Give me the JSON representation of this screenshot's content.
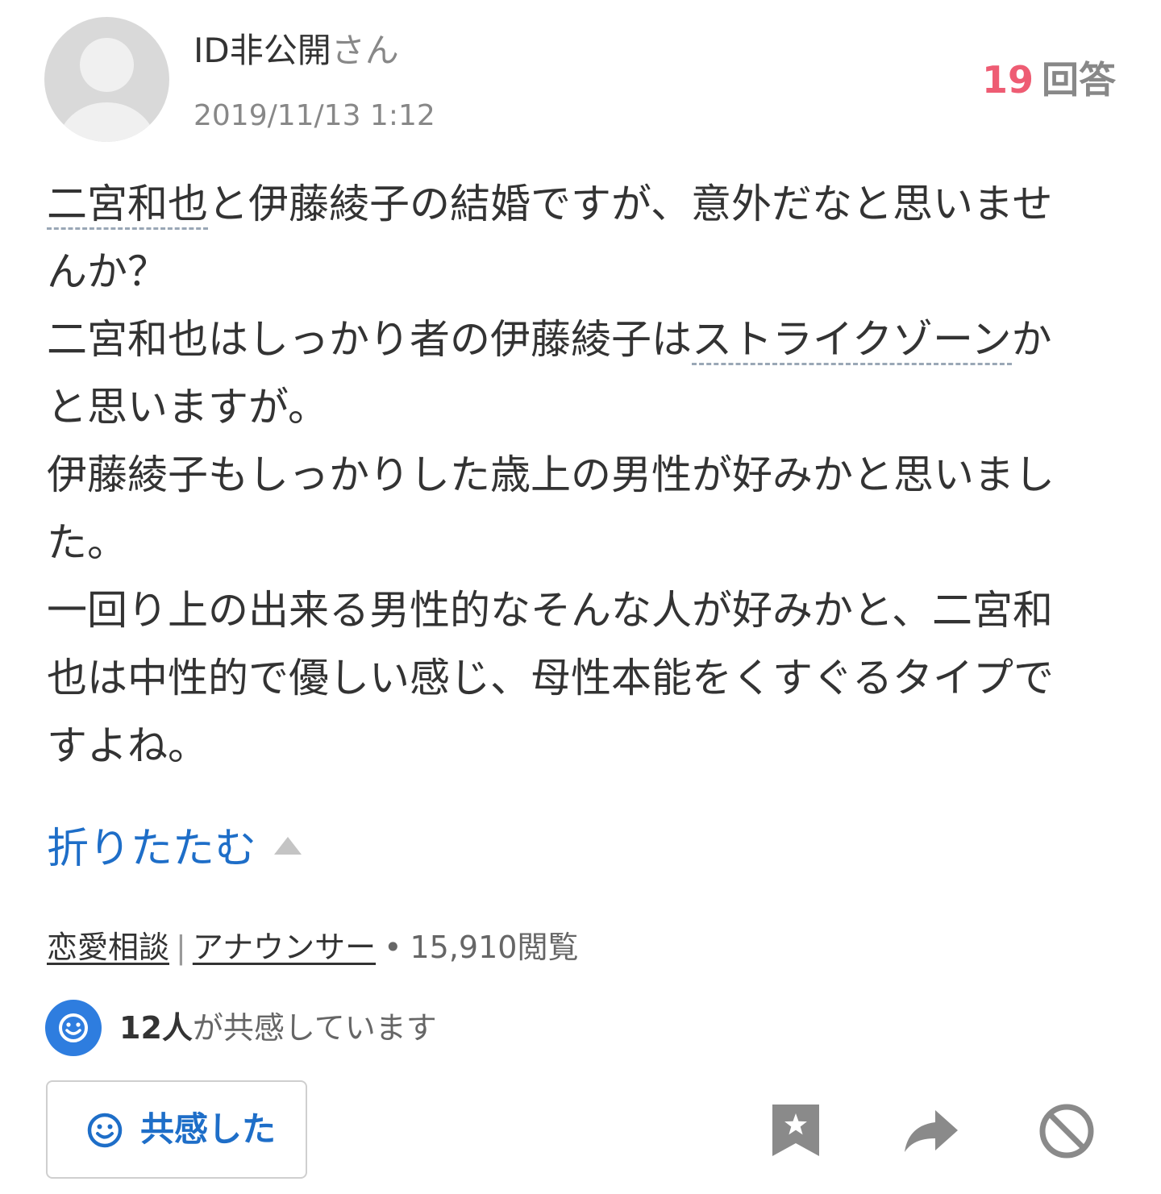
{
  "header": {
    "user_id": "ID非公開",
    "user_suffix": "さん",
    "timestamp": "2019/11/13 1:12",
    "answer_count": "19",
    "answer_label": "回答"
  },
  "question": {
    "p1_kw": "二宮和也",
    "p1_rest": "と伊藤綾子の結婚ですが、意外だなと思いませんか？",
    "p2_pre": "二宮和也はしっかり者の伊藤綾子は",
    "p2_kw": "ストライクゾーン",
    "p2_post": "かと思いますが。",
    "p3": "伊藤綾子もしっかりした歳上の男性が好みかと思いました。",
    "p4": "一回り上の出来る男性的なそんな人が好みかと、二宮和也は中性的で優しい感じ、母性本能をくすぐるタイプですよね。"
  },
  "collapse": {
    "label": "折りたたむ"
  },
  "meta": {
    "category1": "恋愛相談",
    "separator": "|",
    "category2": "アナウンサー",
    "dot": "•",
    "views": "15,910閲覧"
  },
  "empathy": {
    "count": "12人",
    "text": "が共感しています"
  },
  "actions": {
    "empathy_button": "共感した"
  },
  "icons": {
    "avatar": "default-avatar-icon",
    "smile": "smile-icon",
    "bookmark": "bookmark-star-icon",
    "share": "share-arrow-icon",
    "report": "block-icon"
  },
  "colors": {
    "accent_blue": "#1e6ec8",
    "answer_pink": "#ee5c73",
    "icon_gray": "#8a8a8a"
  }
}
